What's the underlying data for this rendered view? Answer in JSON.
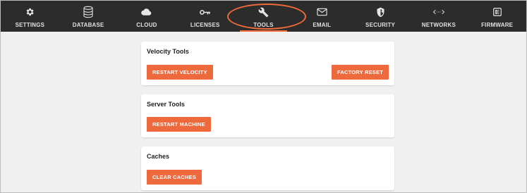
{
  "nav": {
    "items": [
      {
        "label": "SETTINGS",
        "icon": "gear-icon"
      },
      {
        "label": "DATABASE",
        "icon": "database-icon"
      },
      {
        "label": "CLOUD",
        "icon": "cloud-icon"
      },
      {
        "label": "LICENSES",
        "icon": "key-icon"
      },
      {
        "label": "TOOLS",
        "icon": "wrench-icon"
      },
      {
        "label": "EMAIL",
        "icon": "envelope-icon"
      },
      {
        "label": "SECURITY",
        "icon": "shield-icon"
      },
      {
        "label": "NETWORKS",
        "icon": "network-arrows-icon"
      },
      {
        "label": "FIRMWARE",
        "icon": "chip-icon"
      }
    ],
    "active": "TOOLS"
  },
  "colors": {
    "nav_bg": "#2c2c2c",
    "accent": "#ee6a3c",
    "page_bg": "#f0f0f0",
    "card_bg": "#ffffff"
  },
  "cards": {
    "velocity": {
      "title": "Velocity Tools",
      "restart_label": "RESTART VELOCITY",
      "factory_reset_label": "FACTORY RESET"
    },
    "server": {
      "title": "Server Tools",
      "restart_machine_label": "RESTART MACHINE"
    },
    "caches": {
      "title": "Caches",
      "clear_label": "CLEAR CACHES"
    }
  }
}
